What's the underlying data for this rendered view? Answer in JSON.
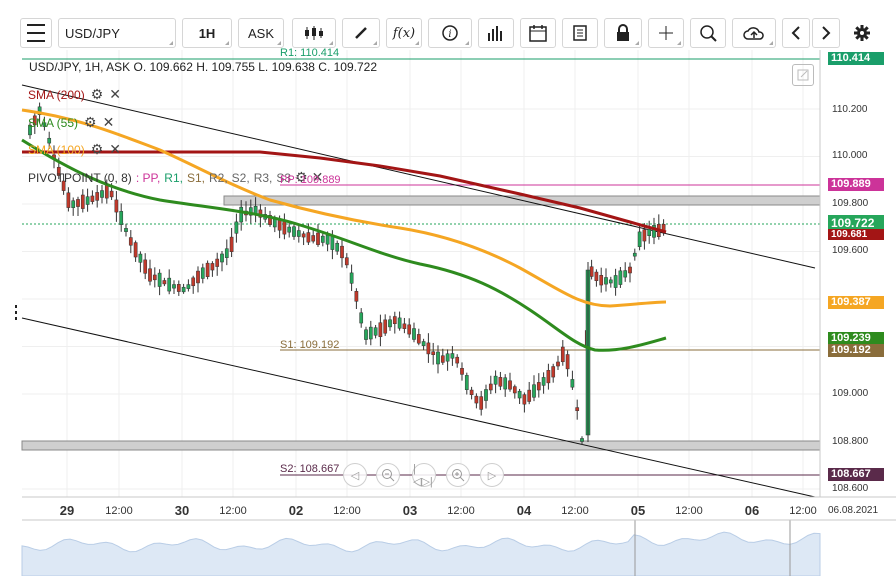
{
  "toolbar": {
    "symbol": "USD/JPY",
    "timeframe": "1H",
    "price_type": "ASK",
    "fx_label": "f(x)"
  },
  "header": {
    "ohlc_text": "USD/JPY, 1H, ASK   O. 109.662  H. 109.755  L. 109.638  C. 109.722"
  },
  "indicators": [
    {
      "label": "SMA (200)",
      "color": "#a31515"
    },
    {
      "label": "SMA (55)",
      "color": "#2e8b1e"
    },
    {
      "label": "SMA (100)",
      "color": "#f5a623"
    }
  ],
  "pivot": {
    "label": "PIVOTPOINT (0, 8)",
    "parts": [
      {
        "text": ": PP,",
        "color": "#cc3399"
      },
      {
        "text": "R1,",
        "color": "#1a9e6a"
      },
      {
        "text": "S1,",
        "color": "#8a6d3b"
      },
      {
        "text": "R2,",
        "color": "#666666"
      },
      {
        "text": "S2,",
        "color": "#666666"
      },
      {
        "text": "R3,",
        "color": "#666666"
      },
      {
        "text": "S3",
        "color": "#666666"
      }
    ],
    "levels": {
      "r1": "R1: 110.414",
      "pp": "PP: 109.889",
      "s1": "S1: 109.192",
      "s2": "S2: 108.667"
    }
  },
  "price_axis": {
    "ticks": [
      "110.200",
      "110.000",
      "109.800",
      "109.600",
      "109.000",
      "108.800",
      "108.600"
    ],
    "labels": [
      {
        "value": "110.414",
        "bg": "#1a9e6a"
      },
      {
        "value": "109.889",
        "bg": "#cc3399"
      },
      {
        "value": "109.722",
        "bg": "#26a65b"
      },
      {
        "value": "109.681",
        "bg": "#a31515"
      },
      {
        "value": "109.387",
        "bg": "#f5a623"
      },
      {
        "value": "109.239",
        "bg": "#2e8b1e"
      },
      {
        "value": "109.192",
        "bg": "#8a6d3b"
      },
      {
        "value": "108.667",
        "bg": "#5a2a4a"
      }
    ]
  },
  "time_axis": [
    {
      "text": "29",
      "big": true
    },
    {
      "text": "12:00",
      "big": false
    },
    {
      "text": "30",
      "big": true
    },
    {
      "text": "12:00",
      "big": false
    },
    {
      "text": "02",
      "big": true
    },
    {
      "text": "12:00",
      "big": false
    },
    {
      "text": "03",
      "big": true
    },
    {
      "text": "12:00",
      "big": false
    },
    {
      "text": "04",
      "big": true
    },
    {
      "text": "12:00",
      "big": false
    },
    {
      "text": "05",
      "big": true
    },
    {
      "text": "12:00",
      "big": false
    },
    {
      "text": "06",
      "big": true
    },
    {
      "text": "12:00",
      "big": false
    },
    {
      "text": "06.08.2021",
      "big": false
    }
  ],
  "colors": {
    "up": "#26a65b",
    "down": "#c0392b",
    "sma200": "#a31515",
    "sma55": "#2e8b1e",
    "sma100": "#f5a623"
  }
}
